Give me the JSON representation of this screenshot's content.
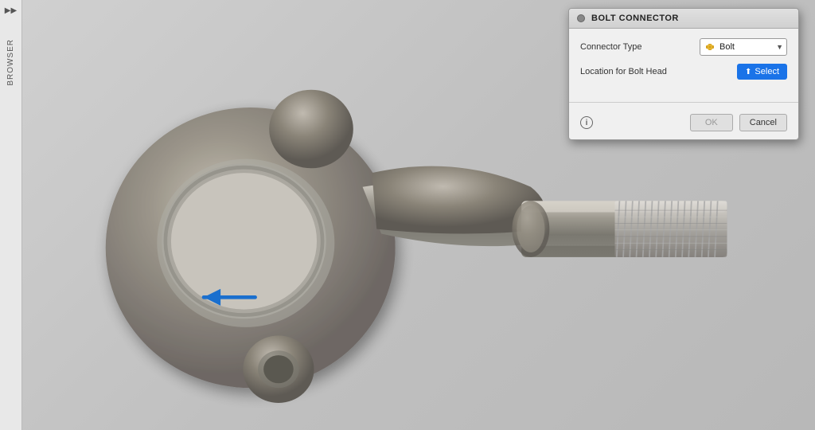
{
  "sidebar": {
    "arrow_label": "▶▶",
    "browser_label": "BROWSER"
  },
  "dialog": {
    "title": "BOLT CONNECTOR",
    "connector_type_label": "Connector Type",
    "connector_type_value": "Bolt",
    "location_label": "Location for Bolt Head",
    "select_button_label": "Select",
    "ok_label": "OK",
    "cancel_label": "Cancel",
    "info_icon": "i"
  },
  "colors": {
    "select_button_bg": "#1a73e8",
    "dialog_bg": "#f0f0f0",
    "viewport_bg": "#c8c8c8"
  }
}
